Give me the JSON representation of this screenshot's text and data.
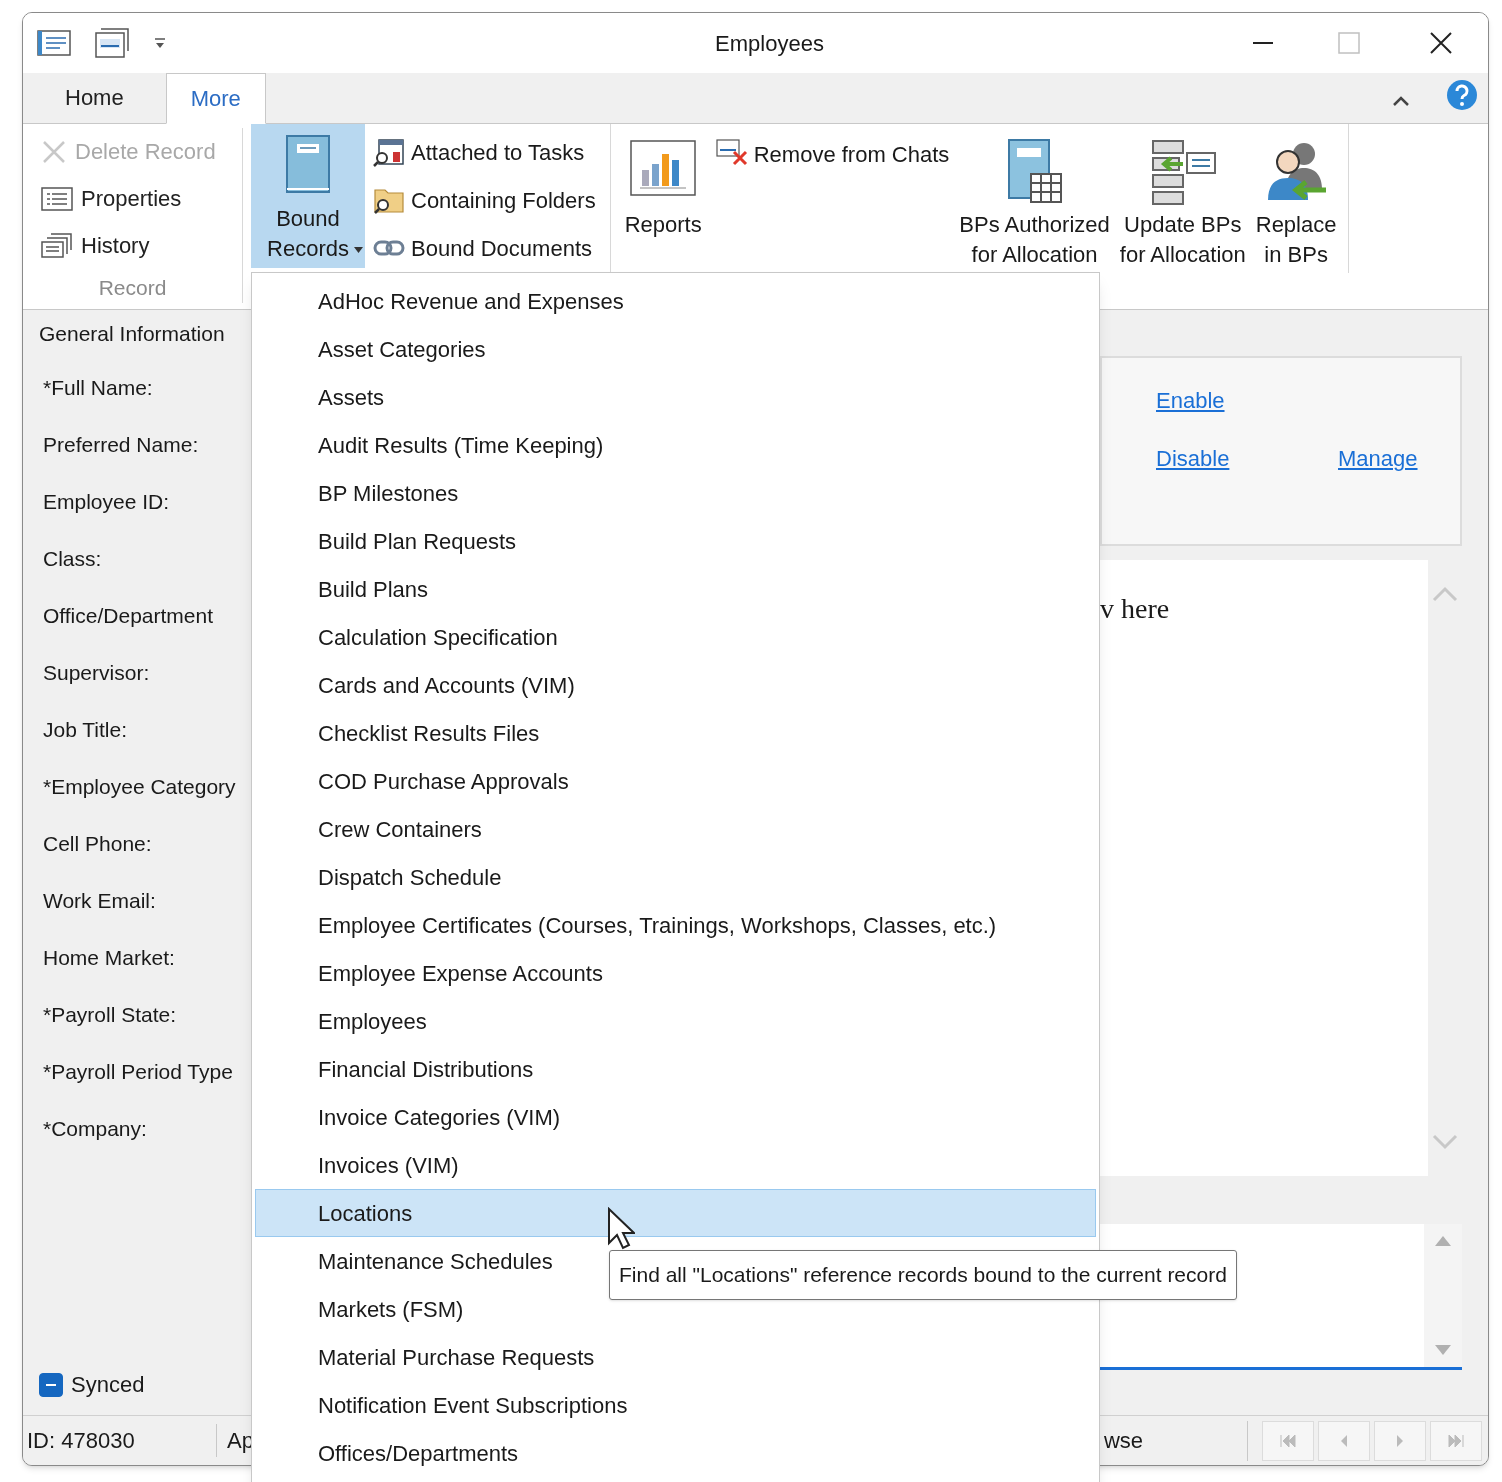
{
  "window": {
    "title": "Employees"
  },
  "tabs": [
    {
      "label": "Home",
      "selected": false
    },
    {
      "label": "More",
      "selected": true
    }
  ],
  "ribbon": {
    "record_group": {
      "label": "Record",
      "items": [
        {
          "kind": "delete",
          "label": "Delete Record",
          "disabled": true
        },
        {
          "kind": "properties",
          "label": "Properties",
          "disabled": false
        },
        {
          "kind": "history",
          "label": "History",
          "disabled": false
        }
      ]
    },
    "bound_records": {
      "label": "Bound\nRecords",
      "pressed": true
    },
    "links": [
      {
        "kind": "tasks",
        "label": "Attached to Tasks"
      },
      {
        "kind": "folders",
        "label": "Containing Folders"
      },
      {
        "kind": "documents",
        "label": "Bound Documents"
      }
    ],
    "reports": {
      "label": "Reports"
    },
    "remove_from_chats": {
      "label": "Remove from Chats"
    },
    "large_buttons": [
      {
        "kind": "authorized",
        "label": "BPs Authorized\nfor Allocation"
      },
      {
        "kind": "update",
        "label": "Update BPs\nfor Allocation"
      },
      {
        "kind": "replace",
        "label": "Replace\nin BPs"
      }
    ]
  },
  "form": {
    "section": "General Information",
    "fields": [
      "*Full Name:",
      "Preferred Name:",
      "Employee ID:",
      "Class:",
      "Office/Department",
      "Supervisor:",
      "Job Title:",
      "*Employee Category",
      "Cell Phone:",
      "Work Email:",
      "Home Market:",
      "*Payroll State:",
      "*Payroll Period Type",
      "*Company:"
    ],
    "synced": {
      "label": "Synced",
      "indeterminate": true
    }
  },
  "side_panel": {
    "links": [
      "Enable",
      "Disable",
      "Manage"
    ],
    "preview_text": "v here"
  },
  "status_bar": {
    "id": "ID: 478030",
    "field_2": "Ap",
    "field_3": "wse"
  },
  "menu": {
    "items": [
      {
        "label": "AdHoc Revenue and Expenses",
        "selected": false
      },
      {
        "label": "Asset Categories",
        "selected": false
      },
      {
        "label": "Assets",
        "selected": false
      },
      {
        "label": "Audit Results (Time Keeping)",
        "selected": false
      },
      {
        "label": "BP Milestones",
        "selected": false
      },
      {
        "label": "Build Plan Requests",
        "selected": false
      },
      {
        "label": "Build Plans",
        "selected": false
      },
      {
        "label": "Calculation Specification",
        "selected": false
      },
      {
        "label": "Cards and Accounts (VIM)",
        "selected": false
      },
      {
        "label": "Checklist Results Files",
        "selected": false
      },
      {
        "label": "COD Purchase Approvals",
        "selected": false
      },
      {
        "label": "Crew Containers",
        "selected": false
      },
      {
        "label": "Dispatch Schedule",
        "selected": false
      },
      {
        "label": "Employee Certificates (Courses, Trainings, Workshops, Classes, etc.)",
        "selected": false
      },
      {
        "label": "Employee Expense Accounts",
        "selected": false
      },
      {
        "label": "Employees",
        "selected": false
      },
      {
        "label": "Financial Distributions",
        "selected": false
      },
      {
        "label": "Invoice Categories (VIM)",
        "selected": false
      },
      {
        "label": "Invoices (VIM)",
        "selected": false
      },
      {
        "label": "Locations",
        "selected": true
      },
      {
        "label": "Maintenance Schedules",
        "selected": false
      },
      {
        "label": "Markets (FSM)",
        "selected": false
      },
      {
        "label": "Material Purchase Requests",
        "selected": false
      },
      {
        "label": "Notification Event Subscriptions",
        "selected": false
      },
      {
        "label": "Offices/Departments",
        "selected": false
      }
    ]
  },
  "tooltip": {
    "text": "Find all \"Locations\" reference records bound to the current record"
  }
}
